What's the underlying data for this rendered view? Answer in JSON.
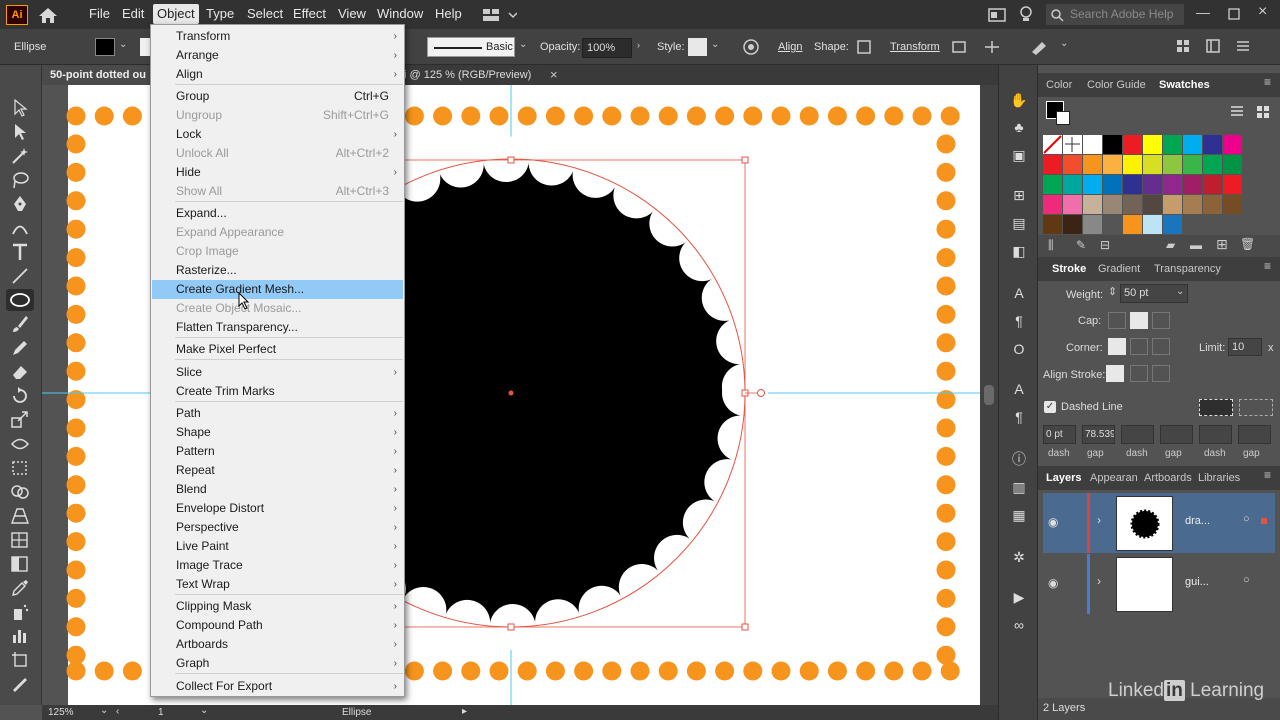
{
  "app": {
    "logo": "Ai"
  },
  "menu": {
    "items": [
      "File",
      "Edit",
      "Object",
      "Type",
      "Select",
      "Effect",
      "View",
      "Window",
      "Help"
    ],
    "active": "Object",
    "search_placeholder": "Search Adobe Help"
  },
  "control_bar": {
    "selection_label": "Ellipse",
    "stroke_style": "Basic",
    "opacity_label": "Opacity:",
    "opacity_value": "100%",
    "style_label": "Style:",
    "align_label": "Align",
    "shape_label": "Shape:",
    "transform_label": "Transform"
  },
  "document": {
    "tab_title": "50-point dotted ou",
    "tab_info": "i @ 125 % (RGB/Preview)",
    "close_glyph": "×"
  },
  "object_menu": {
    "items": [
      {
        "label": "Transform",
        "submenu": true
      },
      {
        "label": "Arrange",
        "submenu": true
      },
      {
        "label": "Align",
        "submenu": true
      },
      {
        "label": "Group",
        "shortcut": "Ctrl+G"
      },
      {
        "label": "Ungroup",
        "shortcut": "Shift+Ctrl+G",
        "disabled": true
      },
      {
        "label": "Lock",
        "submenu": true
      },
      {
        "label": "Unlock All",
        "shortcut": "Alt+Ctrl+2",
        "disabled": true
      },
      {
        "label": "Hide",
        "submenu": true
      },
      {
        "label": "Show All",
        "shortcut": "Alt+Ctrl+3",
        "disabled": true
      },
      {
        "label": "Expand..."
      },
      {
        "label": "Expand Appearance",
        "disabled": true
      },
      {
        "label": "Crop Image",
        "disabled": true
      },
      {
        "label": "Rasterize..."
      },
      {
        "label": "Create Gradient Mesh...",
        "highlighted": true
      },
      {
        "label": "Create Object Mosaic...",
        "disabled": true
      },
      {
        "label": "Flatten Transparency..."
      },
      {
        "label": "Make Pixel Perfect"
      },
      {
        "label": "Slice",
        "submenu": true
      },
      {
        "label": "Create Trim Marks"
      },
      {
        "label": "Path",
        "submenu": true
      },
      {
        "label": "Shape",
        "submenu": true
      },
      {
        "label": "Pattern",
        "submenu": true
      },
      {
        "label": "Repeat",
        "submenu": true
      },
      {
        "label": "Blend",
        "submenu": true
      },
      {
        "label": "Envelope Distort",
        "submenu": true
      },
      {
        "label": "Perspective",
        "submenu": true
      },
      {
        "label": "Live Paint",
        "submenu": true
      },
      {
        "label": "Image Trace",
        "submenu": true
      },
      {
        "label": "Text Wrap",
        "submenu": true
      },
      {
        "label": "Clipping Mask",
        "submenu": true
      },
      {
        "label": "Compound Path",
        "submenu": true
      },
      {
        "label": "Artboards",
        "submenu": true
      },
      {
        "label": "Graph",
        "submenu": true
      },
      {
        "label": "Collect For Export",
        "submenu": true
      }
    ]
  },
  "swatches_panel": {
    "tabs": [
      "Color",
      "Color Guide",
      "Swatches"
    ],
    "active_tab": "Swatches"
  },
  "stroke_panel": {
    "tabs": [
      "Stroke",
      "Gradient",
      "Transparency"
    ],
    "active_tab": "Stroke",
    "weight_label": "Weight:",
    "weight_value": "50 pt",
    "cap_label": "Cap:",
    "corner_label": "Corner:",
    "limit_label": "Limit:",
    "limit_value": "10",
    "limit_suffix": "x",
    "align_label": "Align Stroke:",
    "dashed_label": "Dashed Line",
    "dash_values": [
      "0 pt",
      "78.539",
      "",
      "",
      "",
      ""
    ],
    "dash_labels": [
      "dash",
      "gap",
      "dash",
      "gap",
      "dash",
      "gap"
    ]
  },
  "layers_panel": {
    "tabs": [
      "Layers",
      "Appearan",
      "Artboards",
      "Libraries"
    ],
    "active_tab": "Layers",
    "layers": [
      {
        "name": "dra...",
        "color": "#e0413c",
        "selected": true
      },
      {
        "name": "gui...",
        "color": "#4a7bd9",
        "selected": false
      }
    ],
    "count": "2 Layers"
  },
  "status_bar": {
    "zoom": "125%",
    "artboard": "1",
    "tool": "Ellipse"
  },
  "watermark": {
    "text": "Linked",
    "in": "in",
    "learning": " Learning"
  },
  "colors": {
    "orange_dot": "#f7941d",
    "guide": "#4cc8f0",
    "selection": "#e8523f",
    "menu_highlight": "#91c9f7"
  }
}
